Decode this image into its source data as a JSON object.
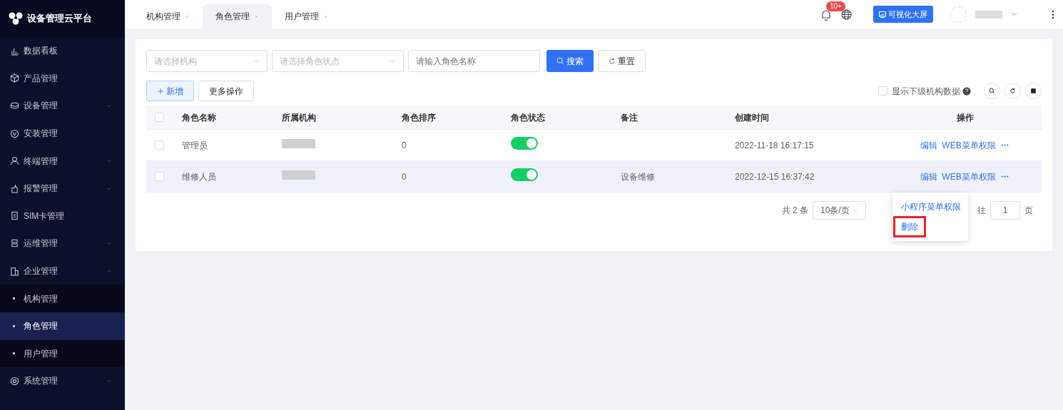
{
  "sidebar": {
    "title": "设备管理云平台",
    "items": [
      {
        "kind": "link",
        "label": "数据看板",
        "selected": false
      },
      {
        "kind": "link",
        "label": "产品管理",
        "selected": false
      },
      {
        "kind": "group",
        "label": "设备管理",
        "expanded": false,
        "selected": false
      },
      {
        "kind": "link",
        "label": "安装管理",
        "selected": false
      },
      {
        "kind": "group",
        "label": "终端管理",
        "expanded": false,
        "selected": false
      },
      {
        "kind": "group",
        "label": "报警管理",
        "expanded": false,
        "selected": false
      },
      {
        "kind": "link",
        "label": "SIM卡管理",
        "selected": false
      },
      {
        "kind": "group",
        "label": "运维管理",
        "expanded": false,
        "selected": false
      },
      {
        "kind": "group",
        "label": "企业管理",
        "expanded": true,
        "selected": false,
        "children": [
          {
            "label": "机构管理",
            "selected": false
          },
          {
            "label": "角色管理",
            "selected": true
          },
          {
            "label": "用户管理",
            "selected": false
          }
        ]
      },
      {
        "kind": "group",
        "label": "系统管理",
        "expanded": false,
        "selected": false
      }
    ]
  },
  "tabs": [
    {
      "label": "机构管理",
      "selected": false
    },
    {
      "label": "角色管理",
      "selected": true
    },
    {
      "label": "用户管理",
      "selected": false
    }
  ],
  "header": {
    "notification_badge": "10+",
    "screen_button": "可视化大屏"
  },
  "filters": {
    "org_placeholder": "请选择机构",
    "status_placeholder": "请选择角色状态",
    "name_placeholder": "请输入角色名称",
    "search_button": "搜索",
    "reset_button": "重置"
  },
  "toolbar": {
    "add_button": "新增",
    "more_button": "更多操作",
    "show_sub_label": "显示下级机构数据",
    "show_sub_checked": false
  },
  "table": {
    "all_checked": false,
    "columns": [
      "角色名称",
      "所属机构",
      "角色排序",
      "角色状态",
      "备注",
      "创建时间",
      "操作"
    ],
    "rows": [
      {
        "checked": false,
        "name": "管理员",
        "sort": "0",
        "enabled": true,
        "created": "2022-11-18 16:17:15",
        "actions": [
          "编辑",
          "WEB菜单权限"
        ],
        "selected": false
      },
      {
        "checked": false,
        "name": "维修人员",
        "sort": "0",
        "enabled": true,
        "remark": "设备维修",
        "created": "2022-12-15 16:37:42",
        "actions": [
          "编辑",
          "WEB菜单权限"
        ],
        "selected": true
      }
    ]
  },
  "pagination": {
    "total": "共 2 条",
    "page_size": "10条/页",
    "goto_label": "往",
    "goto_value": "1",
    "page_unit": "页"
  },
  "dropdown": {
    "items": [
      {
        "label": "小程序菜单权限",
        "highlighted": false
      },
      {
        "label": "删除",
        "highlighted": true
      }
    ]
  }
}
